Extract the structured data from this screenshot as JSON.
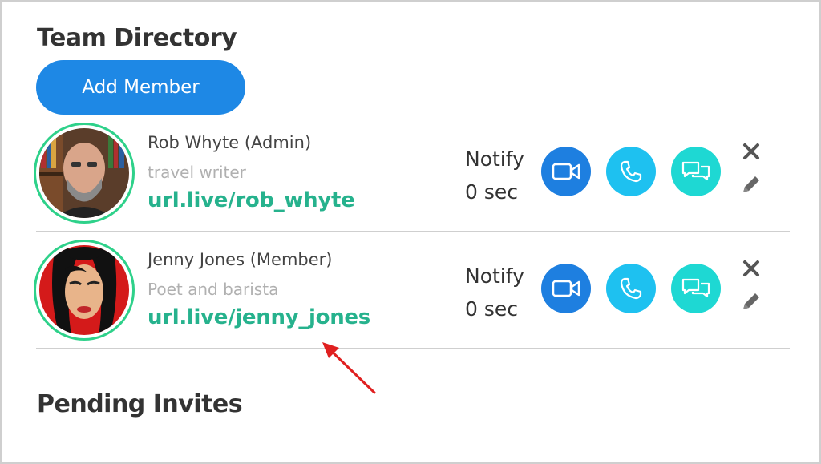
{
  "header": {
    "title": "Team Directory",
    "add_button_label": "Add Member"
  },
  "members": [
    {
      "name": "Rob Whyte (Admin)",
      "bio": "travel writer",
      "url": "url.live/rob_whyte",
      "notify_label": "Notify",
      "notify_value": "0 sec"
    },
    {
      "name": "Jenny Jones (Member)",
      "bio": "Poet and barista",
      "url": "url.live/jenny_jones",
      "notify_label": "Notify",
      "notify_value": "0 sec"
    }
  ],
  "pending": {
    "title": "Pending Invites"
  },
  "colors": {
    "primary_blue": "#1e88e5",
    "video_button": "#1e7fe0",
    "phone_button": "#1ec1f0",
    "chat_button": "#1ed8d3",
    "url_green": "#26b28d",
    "avatar_ring": "#2ed18a",
    "annotation_arrow": "#e02020"
  },
  "icons": [
    "video-camera-icon",
    "phone-icon",
    "chat-bubbles-icon",
    "close-icon",
    "pencil-icon"
  ]
}
